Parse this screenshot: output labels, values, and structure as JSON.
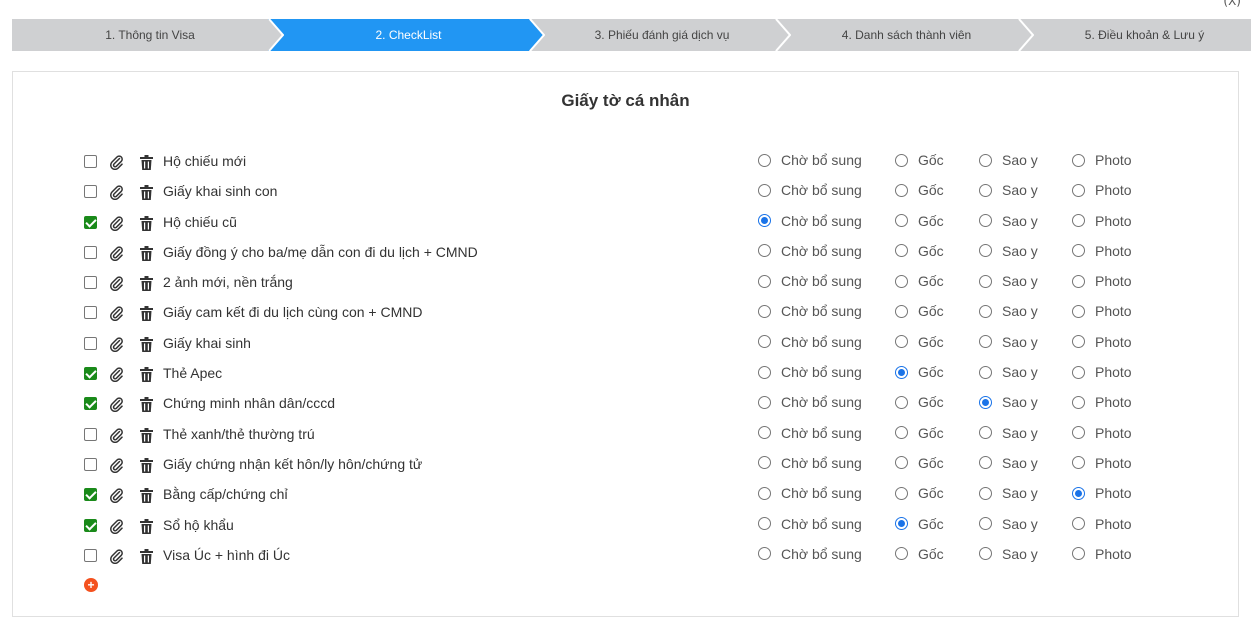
{
  "corner_mark": "(X)",
  "steps": [
    {
      "label": "1. Thông tin Visa",
      "active": false
    },
    {
      "label": "2. CheckList",
      "active": true
    },
    {
      "label": "3. Phiếu đánh giá dịch vụ",
      "active": false
    },
    {
      "label": "4. Danh sách thành viên",
      "active": false
    },
    {
      "label": "5. Điều khoản & Lưu ý",
      "active": false
    }
  ],
  "section_title": "Giấy tờ cá nhân",
  "option_labels": [
    "Chờ bổ sung",
    "Gốc",
    "Sao y",
    "Photo"
  ],
  "documents": [
    {
      "label": "Hộ chiếu mới",
      "checked": false,
      "selected": null
    },
    {
      "label": "Giấy khai sinh con",
      "checked": false,
      "selected": null
    },
    {
      "label": "Hộ chiếu cũ",
      "checked": true,
      "selected": "Chờ bổ sung"
    },
    {
      "label": "Giấy đồng ý cho ba/mẹ dẫn con đi du lịch + CMND",
      "checked": false,
      "selected": null
    },
    {
      "label": "2 ảnh mới, nền trắng",
      "checked": false,
      "selected": null
    },
    {
      "label": "Giấy cam kết đi du lịch cùng con + CMND",
      "checked": false,
      "selected": null
    },
    {
      "label": "Giấy khai sinh",
      "checked": false,
      "selected": null
    },
    {
      "label": "Thẻ Apec",
      "checked": true,
      "selected": "Gốc"
    },
    {
      "label": "Chứng minh nhân dân/cccd",
      "checked": true,
      "selected": "Sao y"
    },
    {
      "label": "Thẻ xanh/thẻ thường trú",
      "checked": false,
      "selected": null
    },
    {
      "label": "Giấy chứng nhận kết hôn/ly hôn/chứng tử",
      "checked": false,
      "selected": null
    },
    {
      "label": "Bằng cấp/chứng chỉ",
      "checked": true,
      "selected": "Photo"
    },
    {
      "label": "Sổ hộ khẩu",
      "checked": true,
      "selected": "Gốc"
    },
    {
      "label": "Visa Úc + hình đi Úc",
      "checked": false,
      "selected": null
    }
  ],
  "add_button_glyph": "+",
  "colors": {
    "step_active": "#2196f3",
    "step_inactive": "#cfd0d2",
    "checkbox_checked": "#1a8a1a",
    "radio_selected": "#1a73e8",
    "add_button": "#f4511e"
  }
}
